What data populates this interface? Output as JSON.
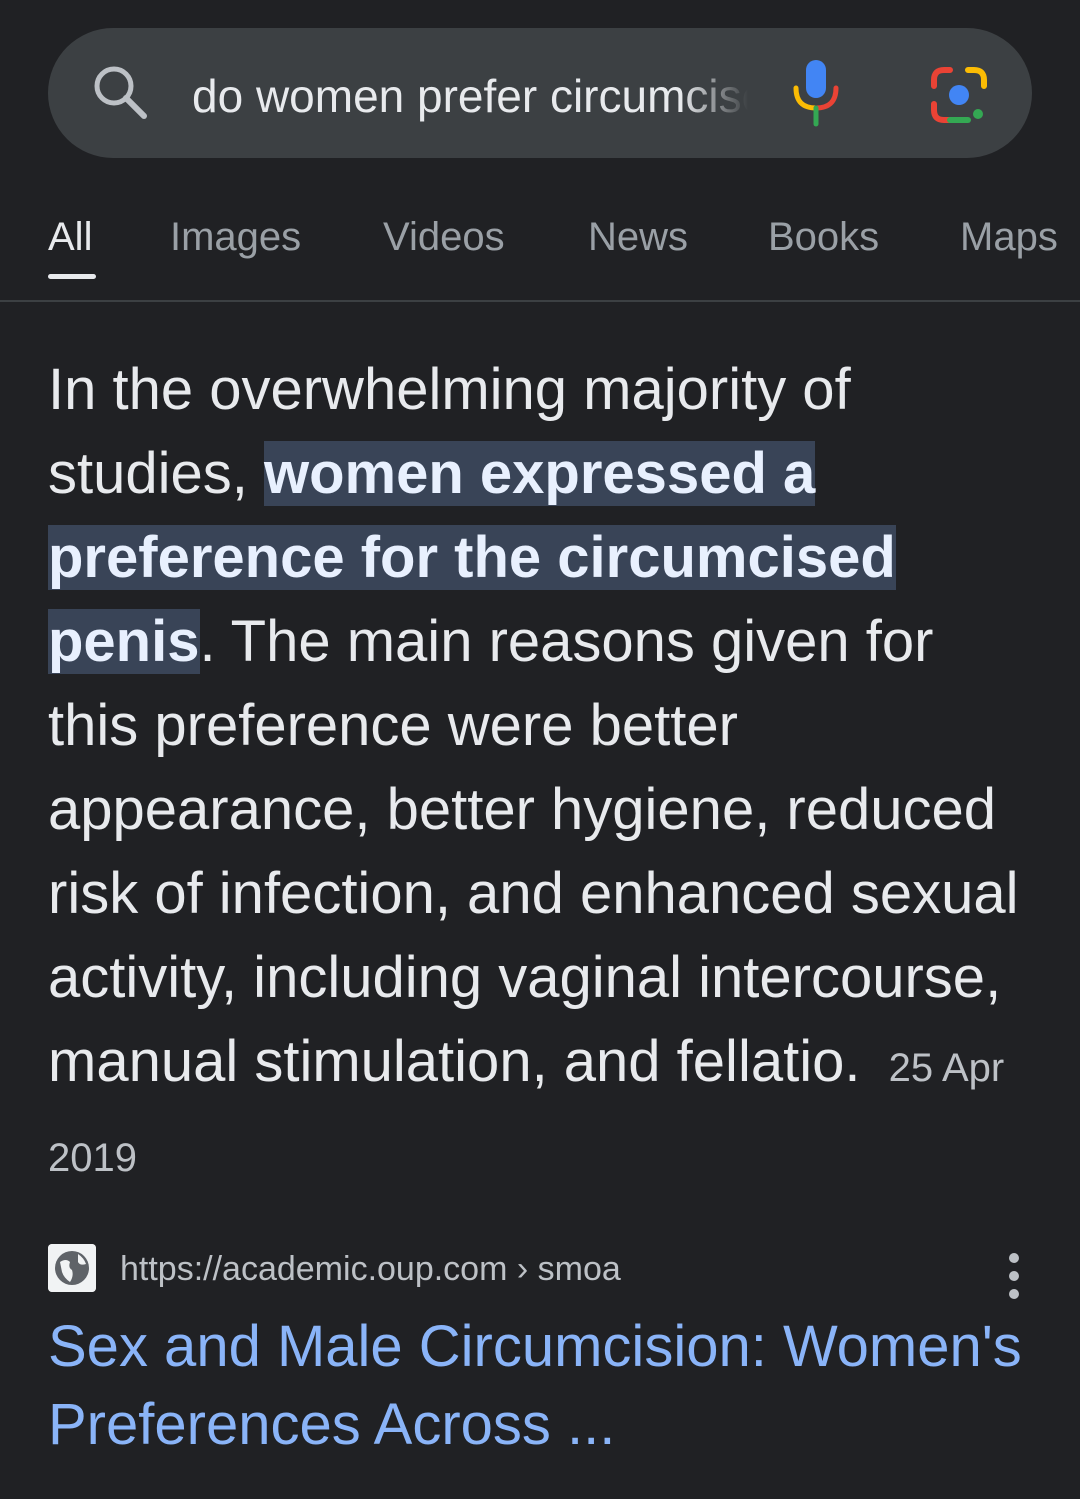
{
  "search": {
    "query": "do women prefer circumcised"
  },
  "tabs": [
    {
      "label": "All",
      "active": true
    },
    {
      "label": "Images",
      "active": false
    },
    {
      "label": "Videos",
      "active": false
    },
    {
      "label": "News",
      "active": false
    },
    {
      "label": "Books",
      "active": false
    },
    {
      "label": "Maps",
      "active": false
    }
  ],
  "answer": {
    "text_before": "In the overwhelming majority of studies, ",
    "highlighted": "women expressed a preference for the circumcised penis",
    "text_after": ". The main reasons given for this preference were better appearance, better hygiene, reduced risk of infection, and enhanced sexual activity, including vaginal intercourse, manual stimulation, and fellatio.",
    "date": "25 Apr 2019"
  },
  "result": {
    "url": "https://academic.oup.com › smoa",
    "title": "Sex and Male Circumcision: Women's Preferences Across ..."
  },
  "icons": {
    "search": "search-icon",
    "mic": "microphone-icon",
    "lens": "google-lens-icon",
    "favicon": "globe-icon",
    "more": "more-vertical-icon"
  },
  "colors": {
    "background": "#202124",
    "search_bar": "#3c4043",
    "highlight": "#394457",
    "link": "#8ab4f8",
    "google_blue": "#4285f4",
    "google_red": "#ea4335",
    "google_yellow": "#fbbc04",
    "google_green": "#34a853"
  }
}
